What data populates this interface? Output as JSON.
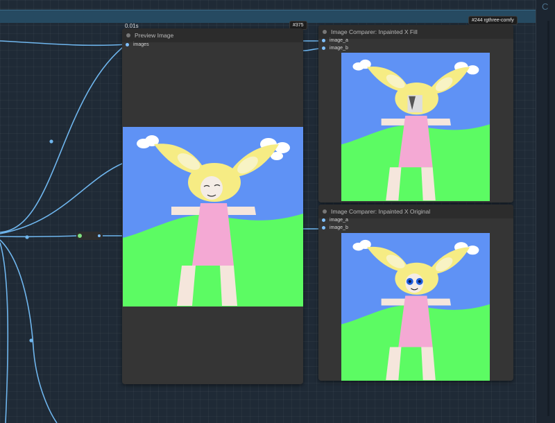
{
  "canvas": {
    "background": "#1f2a36",
    "link_color": "#6fb6ee",
    "right_panel_glyph": "C"
  },
  "preview_node": {
    "title": "Preview Image",
    "exec_time": "0.01s",
    "badge": "#375",
    "input_slot": "images"
  },
  "comparer_fill": {
    "title": "Image Comparer: Inpainted X Fill",
    "badge": "#244 rgthree-comfy",
    "slots": [
      "image_a",
      "image_b"
    ]
  },
  "comparer_original": {
    "title": "Image Comparer: Inpainted X Original",
    "slots": [
      "image_a",
      "image_b"
    ]
  },
  "colors": {
    "sky": "#5f92f5",
    "grass": "#5cfb63",
    "hair": "#f6ec84",
    "dress": "#f4a9d4",
    "skin": "#f5e6dc",
    "node_bg": "#353535",
    "node_header": "#2c2c2c",
    "slot_dot": "#7fc0ff"
  }
}
